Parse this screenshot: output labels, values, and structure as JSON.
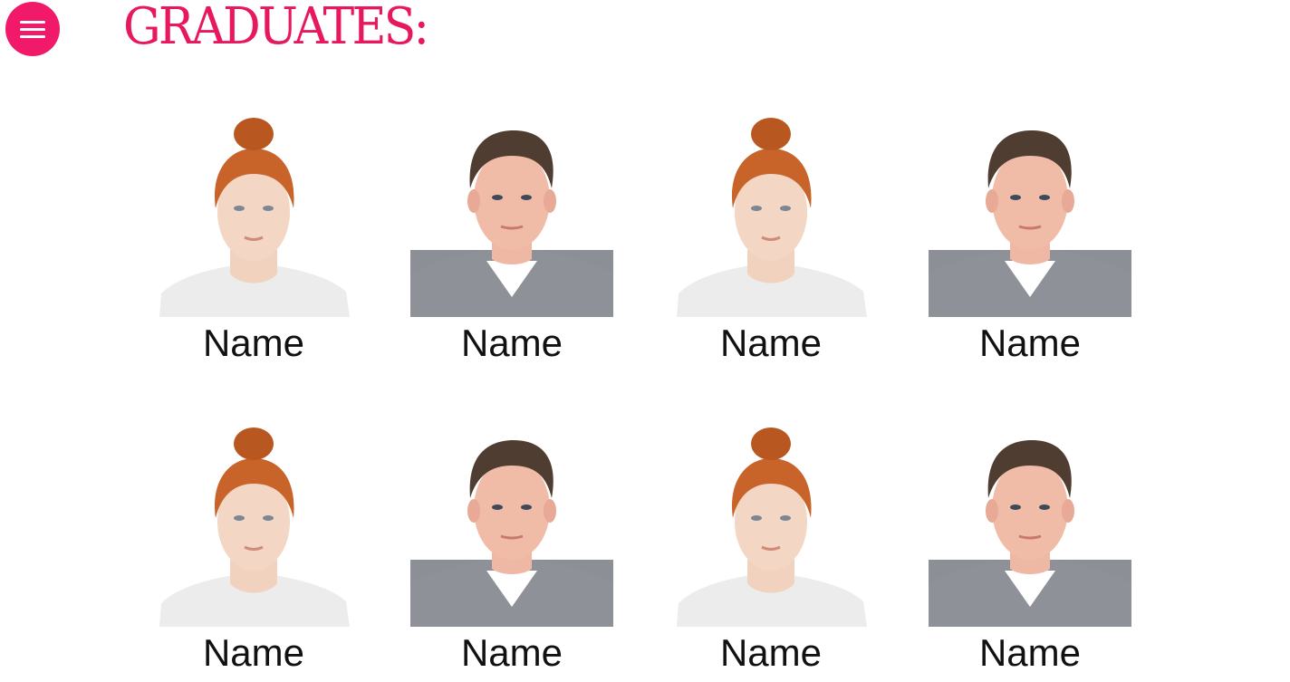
{
  "header": {
    "menu_icon": "hamburger-menu-icon",
    "title": "GRADUATES:",
    "accent_color": "#f0196a"
  },
  "graduates": [
    {
      "name": "Name",
      "photo": "portrait-woman-red-hair"
    },
    {
      "name": "Name",
      "photo": "portrait-man-gray-sweater"
    },
    {
      "name": "Name",
      "photo": "portrait-woman-red-hair"
    },
    {
      "name": "Name",
      "photo": "portrait-man-gray-sweater"
    },
    {
      "name": "Name",
      "photo": "portrait-woman-red-hair"
    },
    {
      "name": "Name",
      "photo": "portrait-man-gray-sweater"
    },
    {
      "name": "Name",
      "photo": "portrait-woman-red-hair"
    },
    {
      "name": "Name",
      "photo": "portrait-man-gray-sweater"
    }
  ]
}
